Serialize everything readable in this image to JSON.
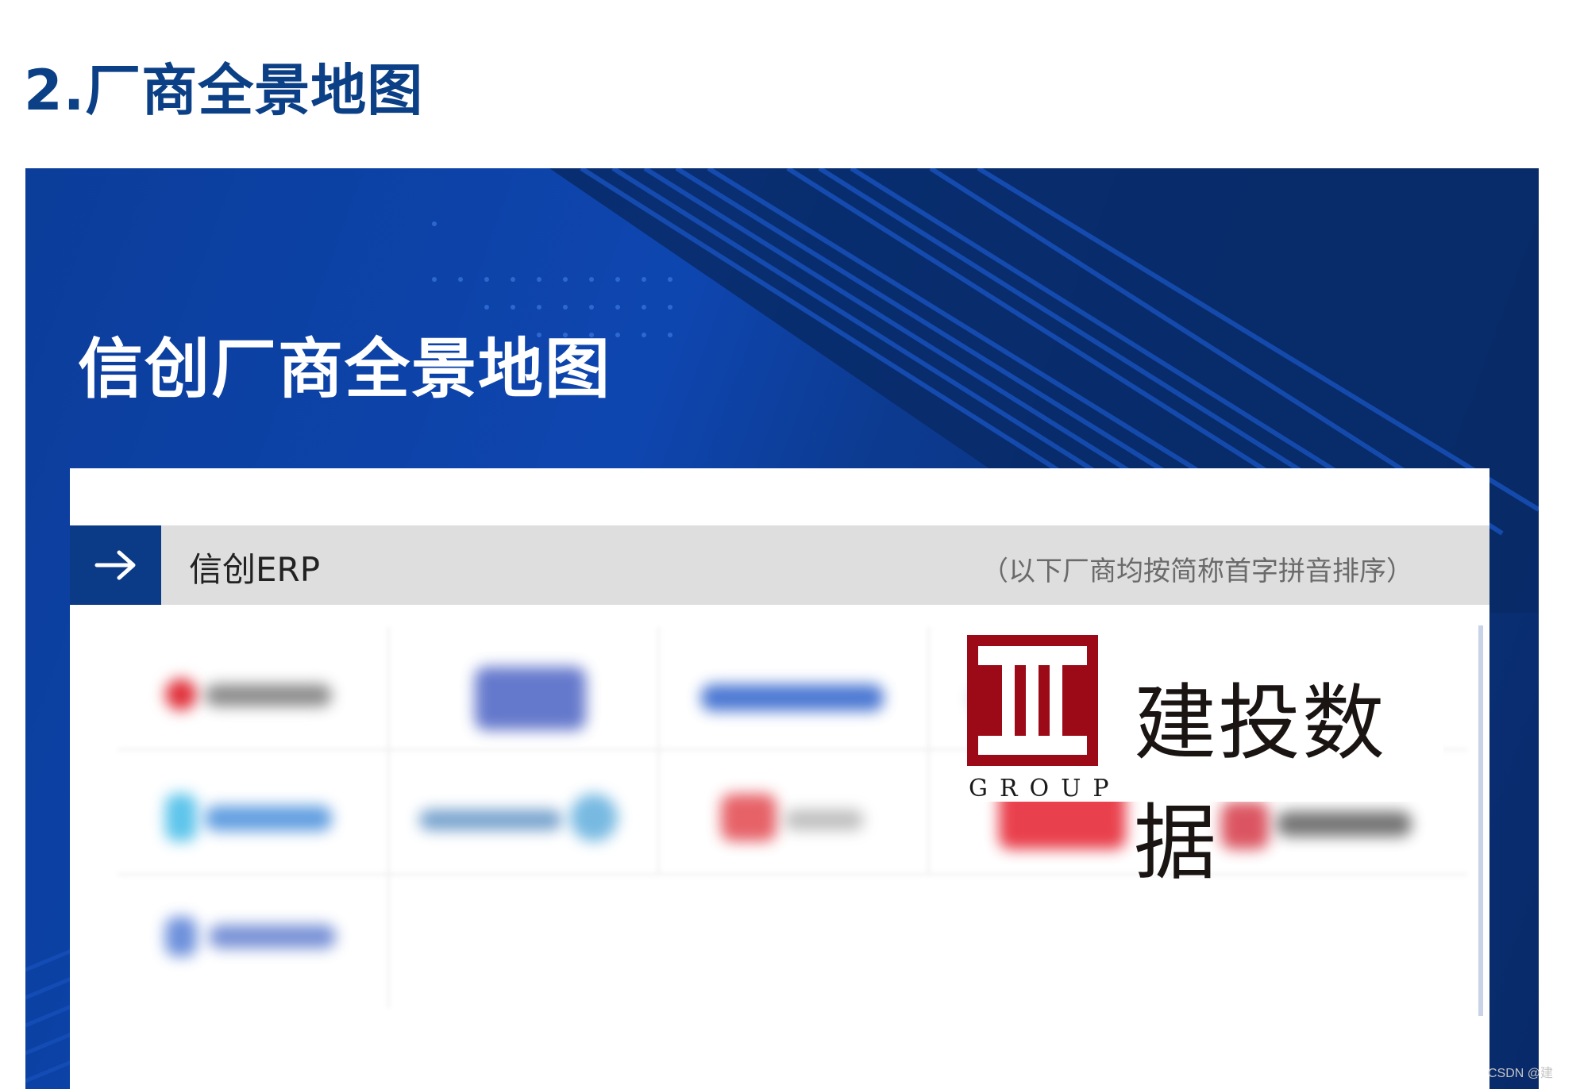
{
  "heading": {
    "title": "2.厂商全景地图"
  },
  "banner": {
    "title": "信创厂商全景地图"
  },
  "category": {
    "title": "信创ERP",
    "note": "（以下厂商均按简称首字拼音排序）",
    "arrow_icon": "arrow-right-icon"
  },
  "featured_vendor": {
    "name": "建投数据",
    "group_label": "GROUP",
    "mark_color": "#9b0a16"
  },
  "watermark": "CSDN @建",
  "colors": {
    "title_blue": "#0b3f86",
    "banner_dark": "#0a2f73",
    "banner_light": "#0e46b0",
    "bar_gray": "#dedede",
    "arrow_box": "#0b3a86"
  }
}
